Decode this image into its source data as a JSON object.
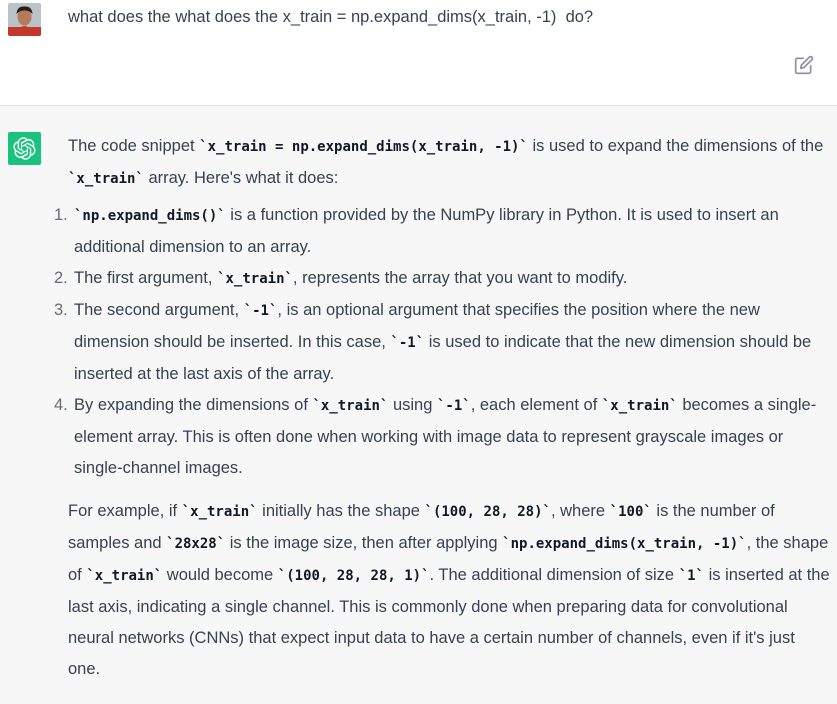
{
  "user_message": {
    "text": "what does the what does the x_train = np.expand_dims(x_train, -1)  do?"
  },
  "assistant_message": {
    "intro": {
      "t1": "The code snippet ",
      "c1": "`x_train = np.expand_dims(x_train, -1)`",
      "t2": " is used to expand the dimensions of the ",
      "c2": "`x_train`",
      "t3": " array. Here's what it does:"
    },
    "items": [
      {
        "num": "1.",
        "c1": "`np.expand_dims()`",
        "t1": " is a function provided by the NumPy library in Python. It is used to insert an additional dimension to an array."
      },
      {
        "num": "2.",
        "t1": "The first argument, ",
        "c1": "`x_train`",
        "t2": ", represents the array that you want to modify."
      },
      {
        "num": "3.",
        "t1": "The second argument, ",
        "c1": "`-1`",
        "t2": ", is an optional argument that specifies the position where the new dimension should be inserted. In this case, ",
        "c2": "`-1`",
        "t3": " is used to indicate that the new dimension should be inserted at the last axis of the array."
      },
      {
        "num": "4.",
        "t1": "By expanding the dimensions of ",
        "c1": "`x_train`",
        "t2": " using ",
        "c2": "`-1`",
        "t3": ", each element of ",
        "c3": "`x_train`",
        "t4": " becomes a single-element array. This is often done when working with image data to represent grayscale images or single-channel images."
      }
    ],
    "example": {
      "t1": "For example, if ",
      "c1": "`x_train`",
      "t2": " initially has the shape ",
      "c2": "`(100, 28, 28)`",
      "t3": ", where ",
      "c3": "`100`",
      "t4": " is the number of samples and ",
      "c4": "`28x28`",
      "t5": " is the image size, then after applying ",
      "c5": "`np.expand_dims(x_train, -1)`",
      "t6": ", the shape of ",
      "c6": "`x_train`",
      "t7": " would become ",
      "c7": "`(100, 28, 28, 1)`",
      "t8": ". The additional dimension of size ",
      "c8": "`1`",
      "t9": " is inserted at the last axis, indicating a single channel. This is commonly done when preparing data for convolutional neural networks (CNNs) that expect input data to have a certain number of channels, even if it's just one."
    }
  },
  "icons": {
    "edit": "edit-icon",
    "bot": "openai-logo-icon",
    "user": "user-avatar"
  },
  "colors": {
    "bot_avatar_bg": "#19c37d",
    "assistant_bg": "#f7f7f8",
    "text": "#374151"
  }
}
